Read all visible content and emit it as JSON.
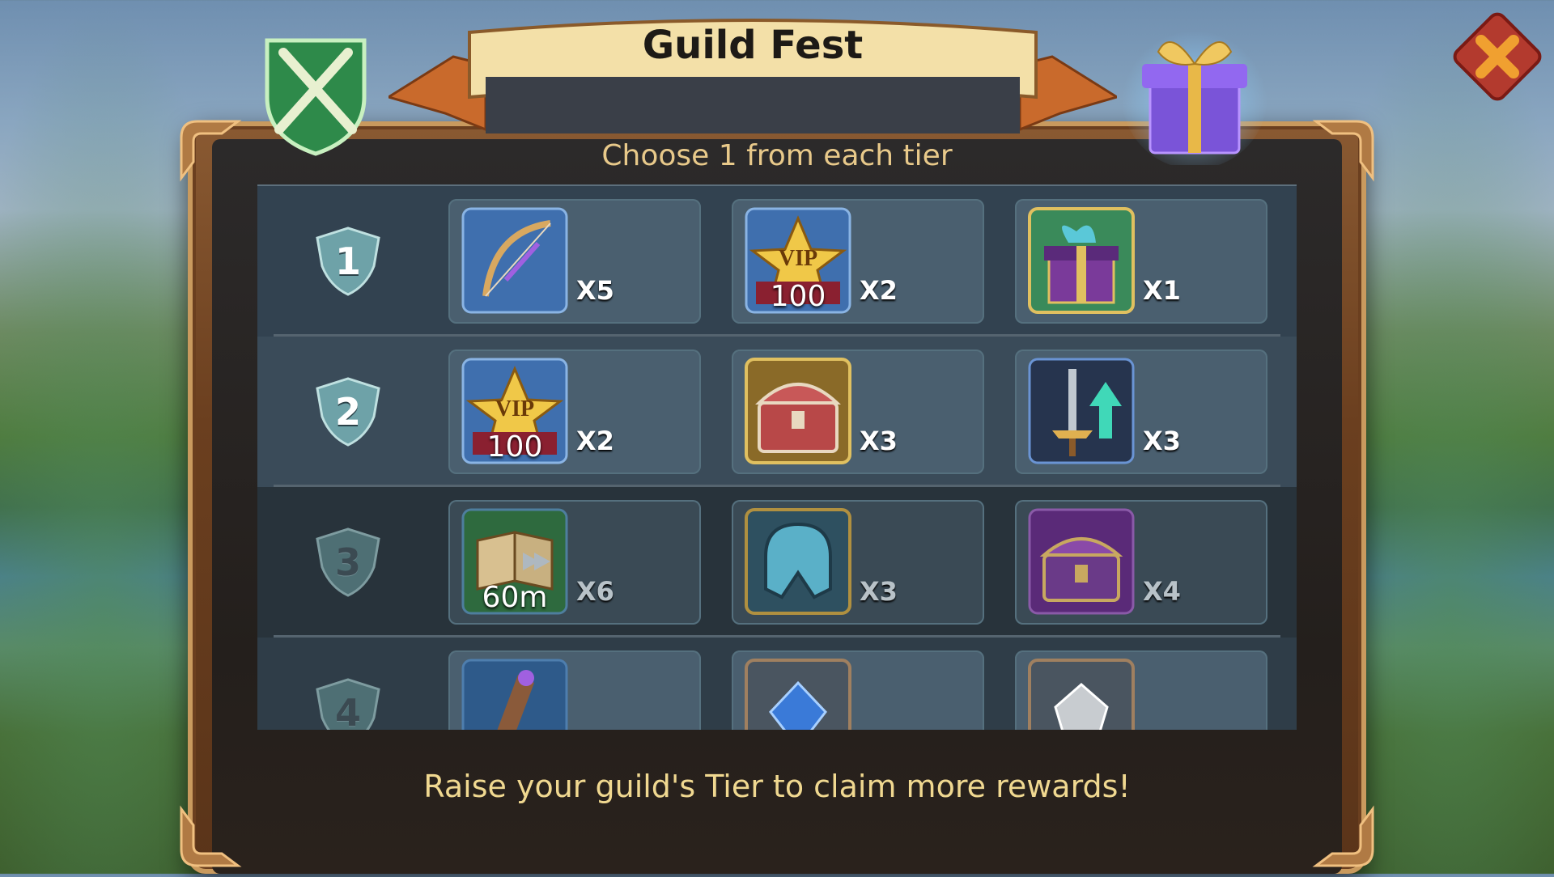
{
  "header": {
    "title": "Guild Fest"
  },
  "subtitle": "Choose 1 from each tier",
  "tiers": [
    {
      "tier": "1",
      "rewards": [
        {
          "icon": "bow-icon",
          "qty": "X5"
        },
        {
          "icon": "vip-star-icon",
          "label": "100",
          "qty": "X2"
        },
        {
          "icon": "gift-box-icon",
          "qty": "X1"
        }
      ]
    },
    {
      "tier": "2",
      "rewards": [
        {
          "icon": "vip-star-icon",
          "label": "100",
          "qty": "X2"
        },
        {
          "icon": "treasure-chest-icon",
          "qty": "X3"
        },
        {
          "icon": "sword-upgrade-icon",
          "qty": "X3"
        }
      ]
    },
    {
      "tier": "3",
      "rewards": [
        {
          "icon": "speedup-book-icon",
          "label": "60m",
          "qty": "X6"
        },
        {
          "icon": "helmet-icon",
          "qty": "X3"
        },
        {
          "icon": "purple-chest-icon",
          "qty": "X4"
        }
      ]
    },
    {
      "tier": "4",
      "rewards": [
        {
          "icon": "scroll-staff-icon"
        },
        {
          "icon": "blue-gem-icon"
        },
        {
          "icon": "white-gem-icon"
        }
      ]
    }
  ],
  "footer": "Raise your guild's Tier to claim more rewards!",
  "colors": {
    "accent_gold": "#e8c98a",
    "close_red": "#b33a2e",
    "close_x": "#f0a030"
  }
}
